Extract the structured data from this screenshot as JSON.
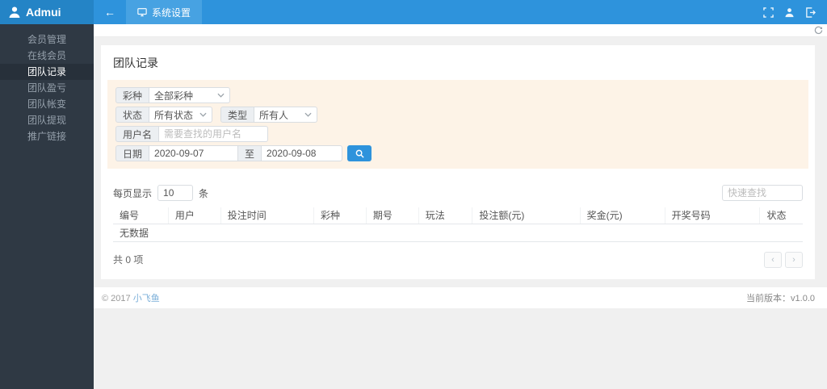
{
  "topbar": {
    "brand": "Admui",
    "back_arrow": "←",
    "tab_label": "系统设置"
  },
  "sidebar": {
    "items": [
      {
        "label": "会员管理",
        "active": false
      },
      {
        "label": "在线会员",
        "active": false
      },
      {
        "label": "团队记录",
        "active": true
      },
      {
        "label": "团队盈亏",
        "active": false
      },
      {
        "label": "团队帐变",
        "active": false
      },
      {
        "label": "团队提现",
        "active": false
      },
      {
        "label": "推广链接",
        "active": false
      }
    ]
  },
  "page": {
    "title": "团队记录"
  },
  "filters": {
    "lottery": {
      "label": "彩种",
      "value": "全部彩种"
    },
    "status": {
      "label": "状态",
      "value": "所有状态"
    },
    "type": {
      "label": "类型",
      "value": "所有人"
    },
    "username": {
      "label": "用户名",
      "placeholder": "需要查找的用户名"
    },
    "date": {
      "label": "日期",
      "from": "2020-09-07",
      "to_label": "至",
      "to": "2020-09-08"
    }
  },
  "table": {
    "page_size": {
      "prefix": "每页显示",
      "value": "10",
      "suffix": "条"
    },
    "quick_search_placeholder": "快速查找",
    "headers": [
      "编号",
      "用户",
      "投注时间",
      "彩种",
      "期号",
      "玩法",
      "投注额(元)",
      "奖金(元)",
      "开奖号码",
      "状态"
    ],
    "empty_text": "无数据",
    "total_text": "共 0 项"
  },
  "pagination": {
    "prev": "‹",
    "next": "›"
  },
  "footer": {
    "copyright": "© 2017",
    "brand_link": "小飞鱼",
    "version": "当前版本：v1.0.0"
  },
  "colors": {
    "topbar": "#2e93dc",
    "topbar_brand": "#2484c6",
    "topbar_tab": "#47a2e2",
    "sidebar": "#2f3944",
    "filter_panel": "#fdf3e7",
    "accent": "#2e93dc"
  }
}
